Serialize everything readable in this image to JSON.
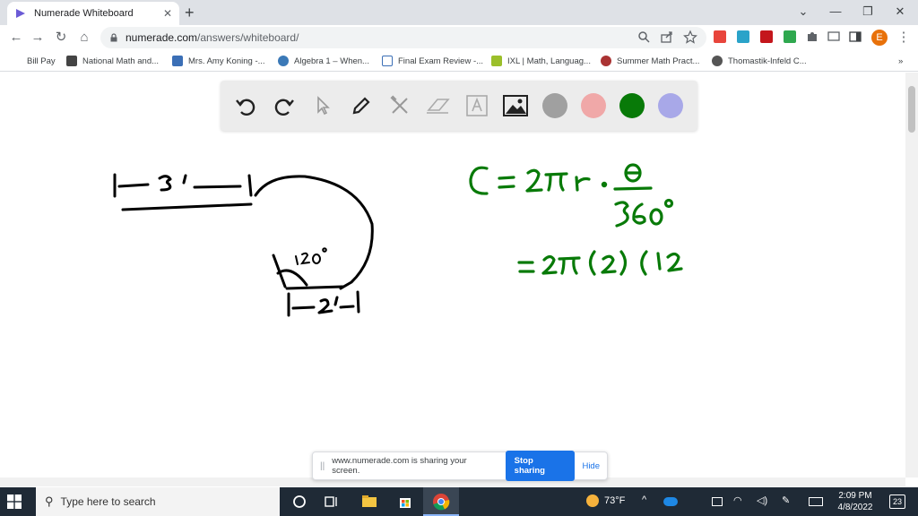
{
  "browser": {
    "tab_title": "Numerade Whiteboard",
    "url_domain": "numerade.com",
    "url_path": "/answers/whiteboard/",
    "profile_initial": "E"
  },
  "bookmarks": [
    {
      "label": "Bill Pay"
    },
    {
      "label": "National Math and..."
    },
    {
      "label": "Mrs. Amy Koning -..."
    },
    {
      "label": "Algebra 1 – When..."
    },
    {
      "label": "Final Exam Review -..."
    },
    {
      "label": "IXL | Math, Languag..."
    },
    {
      "label": "Summer Math Pract..."
    },
    {
      "label": "Thomastik-Infeld C..."
    }
  ],
  "whiteboard": {
    "tools": [
      "undo-icon",
      "redo-icon",
      "pointer-icon",
      "pen-icon",
      "tools-icon",
      "eraser-icon",
      "text-icon",
      "image-icon"
    ],
    "colors": [
      "#a0a0a0",
      "#f0a8a8",
      "#087a08",
      "#a8a8e8"
    ],
    "handwriting": {
      "length_top": "3'",
      "angle": "120°",
      "length_bottom": "2'",
      "formula_line1": "C = 2πr · θ/360°",
      "formula_line2": "= 2π(2)(12"
    }
  },
  "share_banner": {
    "message": "www.numerade.com is sharing your screen.",
    "stop_label": "Stop sharing",
    "hide_label": "Hide"
  },
  "taskbar": {
    "search_placeholder": "Type here to search",
    "temperature": "73°F",
    "time": "2:09 PM",
    "date": "4/8/2022",
    "notifications": "23"
  }
}
